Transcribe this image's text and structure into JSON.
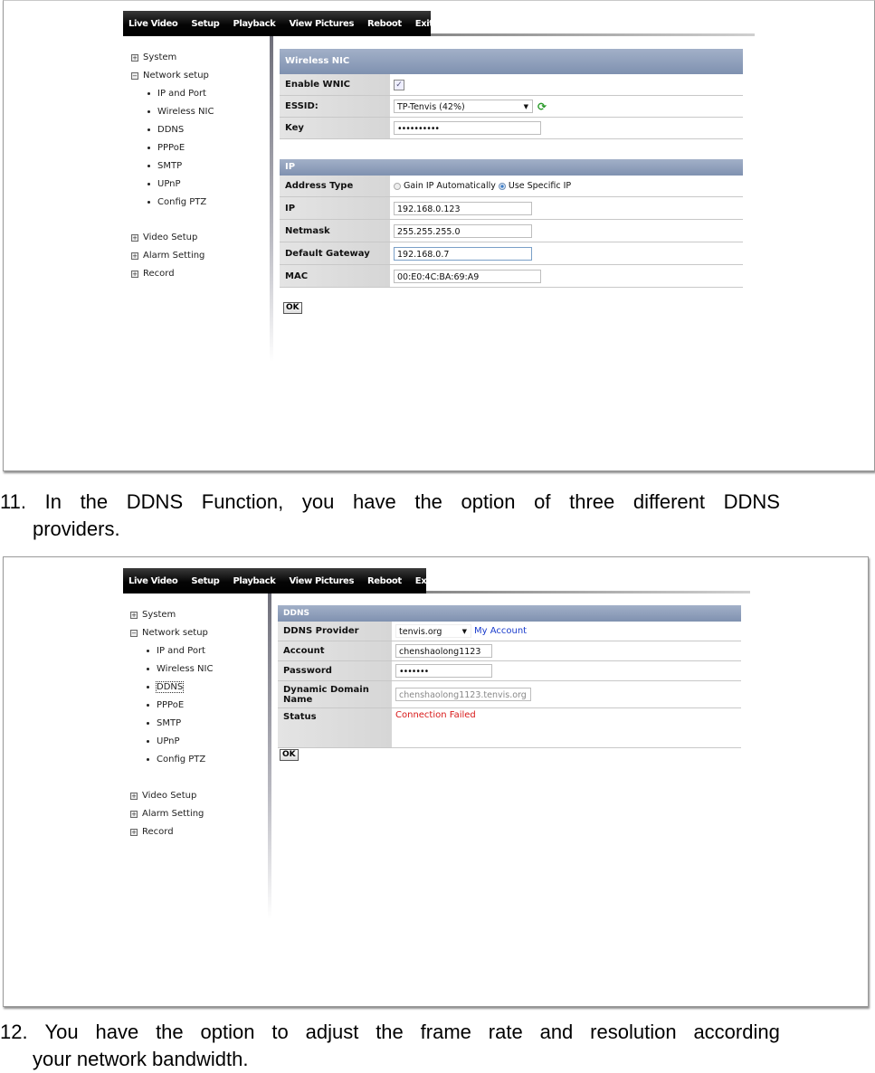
{
  "screenshot1": {
    "nav": [
      "Live Video",
      "Setup",
      "Playback",
      "View Pictures",
      "Reboot",
      "Exit"
    ],
    "sidebar": {
      "groups_top": [
        {
          "label": "System",
          "expanded": false
        },
        {
          "label": "Network setup",
          "expanded": true
        }
      ],
      "sub_items": [
        "IP and Port",
        "Wireless NIC",
        "DDNS",
        "PPPoE",
        "SMTP",
        "UPnP",
        "Config PTZ"
      ],
      "groups_bottom": [
        {
          "label": "Video Setup",
          "expanded": false
        },
        {
          "label": "Alarm Setting",
          "expanded": false
        },
        {
          "label": "Record",
          "expanded": false
        }
      ]
    },
    "wireless": {
      "title": "Wireless NIC",
      "enable_label": "Enable WNIC",
      "enable_checked": true,
      "essid_label": "ESSID:",
      "essid_value": "TP-Tenvis (42%)",
      "key_label": "Key",
      "key_value": "••••••••••"
    },
    "ip": {
      "title": "IP",
      "address_type_label": "Address Type",
      "option_auto": "Gain IP Automatically",
      "option_specific": "Use Specific IP",
      "selected": "Use Specific IP",
      "ip_label": "IP",
      "ip_value": "192.168.0.123",
      "netmask_label": "Netmask",
      "netmask_value": "255.255.255.0",
      "gateway_label": "Default Gateway",
      "gateway_value": "192.168.0.7",
      "mac_label": "MAC",
      "mac_value": "00:E0:4C:BA:69:A9"
    },
    "ok_label": "OK"
  },
  "caption11": {
    "words": [
      "11.",
      "In",
      "the",
      "DDNS",
      "Function,",
      "you",
      "have",
      "the",
      "option",
      "of",
      "three",
      "different",
      "DDNS"
    ],
    "line2": "providers."
  },
  "screenshot2": {
    "nav": [
      "Live Video",
      "Setup",
      "Playback",
      "View Pictures",
      "Reboot",
      "Exit"
    ],
    "sidebar": {
      "groups_top": [
        {
          "label": "System",
          "expanded": false
        },
        {
          "label": "Network setup",
          "expanded": true
        }
      ],
      "sub_items": [
        "IP and Port",
        "Wireless NIC",
        "DDNS",
        "PPPoE",
        "SMTP",
        "UPnP",
        "Config PTZ"
      ],
      "focused_item": "DDNS",
      "groups_bottom": [
        {
          "label": "Video Setup",
          "expanded": false
        },
        {
          "label": "Alarm Setting",
          "expanded": false
        },
        {
          "label": "Record",
          "expanded": false
        }
      ]
    },
    "ddns": {
      "title": "DDNS",
      "provider_label": "DDNS Provider",
      "provider_value": "tenvis.org",
      "my_account_link": "My Account",
      "account_label": "Account",
      "account_value": "chenshaolong1123",
      "password_label": "Password",
      "password_value": "•••••••",
      "domain_label": "Dynamic Domain Name",
      "domain_value": "chenshaolong1123.tenvis.org",
      "status_label": "Status",
      "status_value": "Connection Failed",
      "status_color": "#d81818"
    },
    "ok_label": "OK"
  },
  "caption12": {
    "words": [
      "12.",
      "You",
      "have",
      "the",
      "option",
      "to",
      "adjust",
      "the",
      "frame",
      "rate",
      "and",
      "resolution",
      "according"
    ],
    "line2": "your network bandwidth."
  }
}
